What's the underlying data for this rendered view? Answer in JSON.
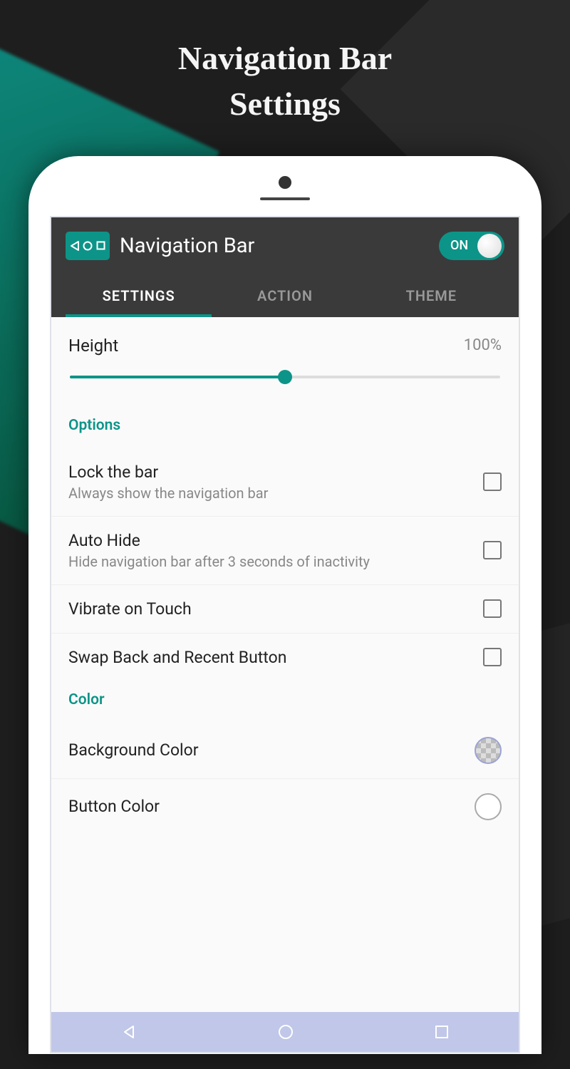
{
  "promo": {
    "title_line1": "Navigation Bar",
    "title_line2": "Settings"
  },
  "header": {
    "app_title": "Navigation Bar",
    "toggle_label": "ON",
    "toggle_on": true
  },
  "tabs": [
    {
      "label": "SETTINGS",
      "active": true
    },
    {
      "label": "ACTION",
      "active": false
    },
    {
      "label": "THEME",
      "active": false
    }
  ],
  "slider": {
    "label": "Height",
    "value_text": "100%",
    "value_percent": 100,
    "thumb_position_percent": 50
  },
  "sections": {
    "options": {
      "header": "Options",
      "items": [
        {
          "title": "Lock the bar",
          "subtitle": "Always show the navigation bar",
          "checked": false
        },
        {
          "title": "Auto Hide",
          "subtitle": "Hide navigation bar after 3 seconds of inactivity",
          "checked": false
        },
        {
          "title": "Vibrate on Touch",
          "subtitle": "",
          "checked": false
        },
        {
          "title": "Swap Back and Recent Button",
          "subtitle": "",
          "checked": false
        }
      ]
    },
    "color": {
      "header": "Color",
      "items": [
        {
          "title": "Background Color",
          "swatch": "transparent"
        },
        {
          "title": "Button Color",
          "swatch": "white"
        }
      ]
    }
  },
  "colors": {
    "accent": "#0d9488"
  }
}
